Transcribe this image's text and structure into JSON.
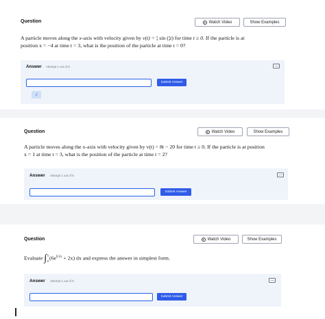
{
  "questions": [
    {
      "label": "Question",
      "watch_video": "Watch Video",
      "show_examples": "Show Examples",
      "line1_a": "A particle moves along the ",
      "line1_b": "x",
      "line1_c": "-axis with velocity given by ",
      "line1_d": "v(t) = ",
      "line1_e": "sin",
      "line1_f": " for time ",
      "line1_g": "t ≥ 0",
      "line1_h": ". If the particle is at",
      "line2": "position x = −4 at time t = 3, what is the position of the particle at time t = 0?",
      "answer_label": "Answer",
      "attempt": "Attempt 1 out of 5",
      "submit": "Submit Answer",
      "sqrt": "√"
    },
    {
      "label": "Question",
      "watch_video": "Watch Video",
      "show_examples": "Show Examples",
      "line1": "A particle moves along the x-axis with velocity given by v(t) = 8t − 20 for time t ≥ 0. If the particle is at position",
      "line2": "x = 1 at time t = 3, what is the position of the particle at time t = 2?",
      "answer_label": "Answer",
      "attempt": "Attempt 1 out of 5",
      "submit": "Submit Answer"
    },
    {
      "label": "Question",
      "watch_video": "Watch Video",
      "show_examples": "Show Examples",
      "evaluate": "Evaluate",
      "upper": "5",
      "lower": "0",
      "integrand": "(6e",
      "exponent": "0.2x",
      "integrand_rest": " + 2x) dx and express the answer in simplest form.",
      "answer_label": "Answer",
      "attempt": "Attempt 1 out of 5",
      "submit": "Submit Answer"
    }
  ]
}
